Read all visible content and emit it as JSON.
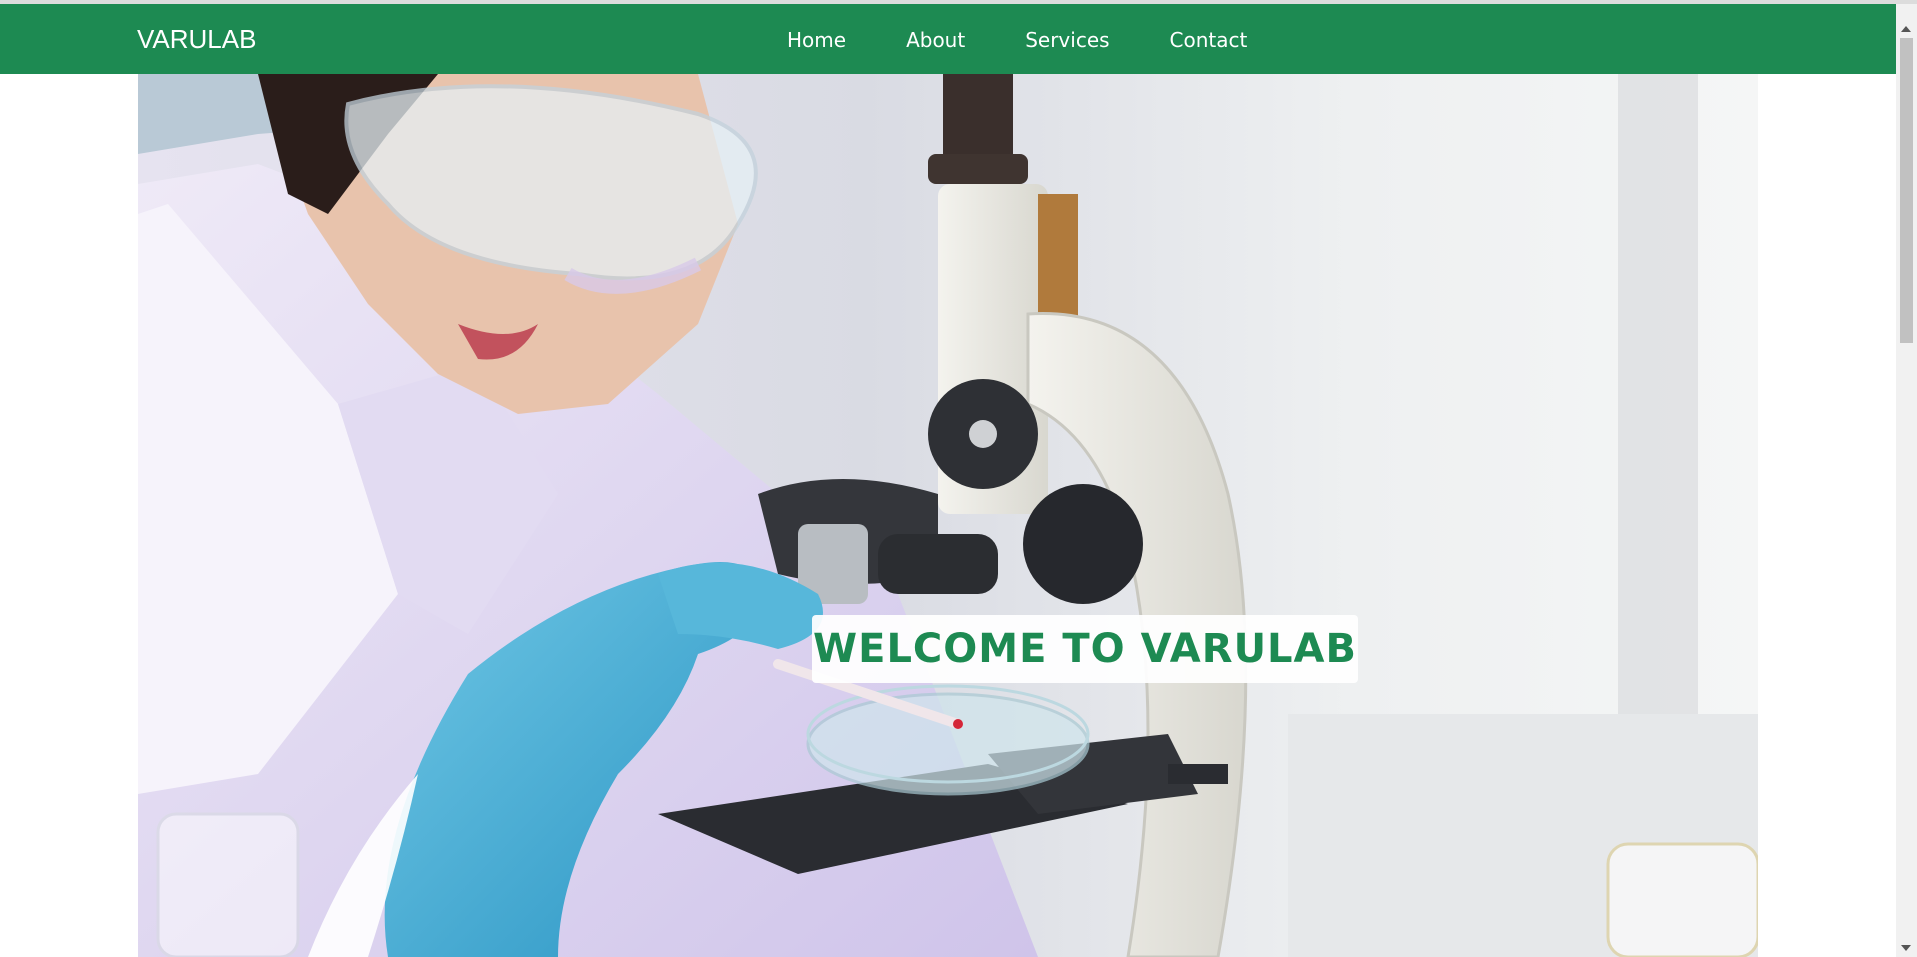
{
  "site": {
    "brand": "VARULAB"
  },
  "nav": {
    "items": [
      {
        "label": "Home"
      },
      {
        "label": "About"
      },
      {
        "label": "Services"
      },
      {
        "label": "Contact"
      }
    ]
  },
  "hero": {
    "heading": "WELCOME TO VARULAB",
    "image_subject": "scientist-with-microscope-photo"
  },
  "colors": {
    "brand_green": "#1d8a52",
    "nav_text": "#ffffff",
    "heading_bg": "#ffffff"
  }
}
